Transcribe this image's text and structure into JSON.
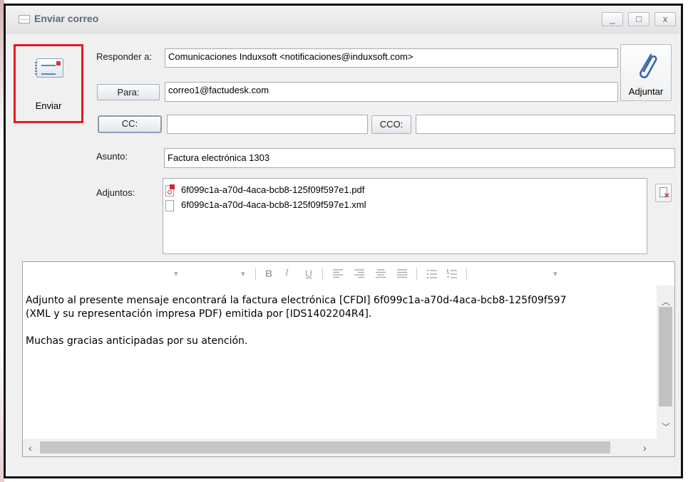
{
  "window": {
    "title": "Enviar correo",
    "minimize_label": "_",
    "maximize_label": "□",
    "close_label": "x"
  },
  "send": {
    "label": "Enviar"
  },
  "attach": {
    "label": "Adjuntar"
  },
  "form": {
    "reply_to_label": "Responder a:",
    "reply_to_value": "Comunicaciones Induxsoft <notificaciones@induxsoft.com>",
    "to_button": "Para:",
    "to_value": "correo1@factudesk.com",
    "cc_button": "CC:",
    "cc_value": "",
    "bcc_button": "CCO:",
    "bcc_value": "",
    "subject_label": "Asunto:",
    "subject_value": "Factura electrónica 1303",
    "attachments_label": "Adjuntos:"
  },
  "attachments": [
    {
      "name": "6f099c1a-a70d-4aca-bcb8-125f09f597e1.pdf",
      "type": "pdf"
    },
    {
      "name": "6f099c1a-a70d-4aca-bcb8-125f09f597e1.xml",
      "type": "file"
    }
  ],
  "toolbar": {
    "bold": "B",
    "italic": "I",
    "underline": "U",
    "dropdown_arrow": "▾"
  },
  "message": {
    "line1": "Adjunto al presente mensaje encontrará la factura electrónica [CFDI] 6f099c1a-a70d-4aca-bcb8-125f09f597",
    "line2": "(XML y su representación impresa PDF) emitida por [IDS1402204R4].",
    "line3": "",
    "line4": "Muchas gracias anticipadas por su atención."
  },
  "colors": {
    "highlight": "#e01c24",
    "title_text": "#5b6a7d",
    "pdf_red": "#d8262e"
  },
  "icons": {
    "title": "mail-window-icon",
    "send": "envelope-icon",
    "attach": "paperclip-icon",
    "remove_attachment": "remove-attachment-icon"
  }
}
